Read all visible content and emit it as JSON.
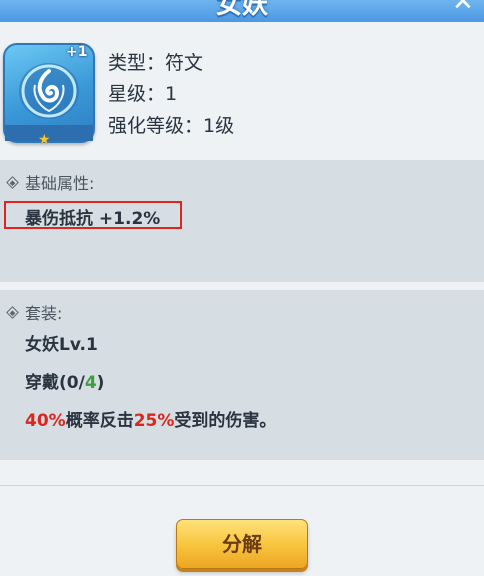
{
  "header": {
    "title": "女妖",
    "close_icon": "close-icon"
  },
  "item": {
    "plus_level": "+1",
    "icon": "rune-icon",
    "star_icon": "star-icon",
    "type_label": "类型：符文",
    "star_label": "星级：1",
    "enhance_label": "强化等级：1级"
  },
  "base_attributes": {
    "title": "基础属性:",
    "attribute": "暴伤抵抗 +1.2%"
  },
  "set_bonus": {
    "title": "套装:",
    "name": "女妖Lv.1",
    "wear_prefix": "穿戴(0/",
    "wear_total": "4",
    "wear_suffix": ")",
    "effect_chance": "40%",
    "effect_middle": "概率反击",
    "effect_percent": "25%",
    "effect_end": "受到的伤害。"
  },
  "colors": {
    "highlight_red": "#d9271e",
    "highlight_green": "#3aa13a",
    "button_gold": "#f8c640",
    "header_blue": "#4b98e3"
  },
  "actions": {
    "decompose_label": "分解"
  }
}
